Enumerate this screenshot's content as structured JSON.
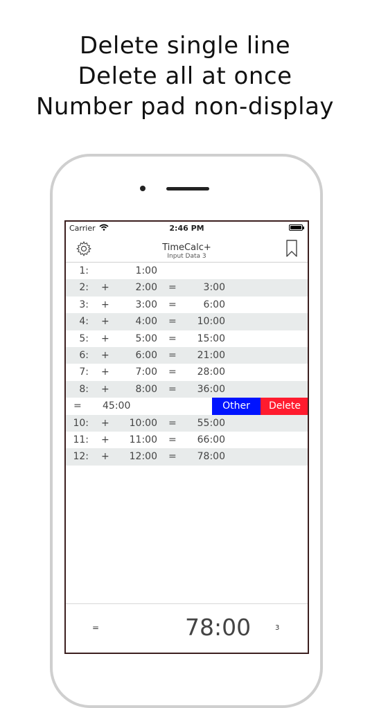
{
  "headline": {
    "line1": "Delete single line",
    "line2": "Delete all at once",
    "line3": "Number pad non-display"
  },
  "status_bar": {
    "carrier": "Carrier",
    "time": "2:46 PM"
  },
  "nav": {
    "title": "TimeCalc+",
    "subtitle": "Input Data 3",
    "left_icon": "gear-icon",
    "right_icon": "bookmark-icon"
  },
  "rows": [
    {
      "num": "1:",
      "op": "",
      "value": "1:00",
      "eq": "",
      "result": ""
    },
    {
      "num": "2:",
      "op": "+",
      "value": "2:00",
      "eq": "=",
      "result": "3:00"
    },
    {
      "num": "3:",
      "op": "+",
      "value": "3:00",
      "eq": "=",
      "result": "6:00"
    },
    {
      "num": "4:",
      "op": "+",
      "value": "4:00",
      "eq": "=",
      "result": "10:00"
    },
    {
      "num": "5:",
      "op": "+",
      "value": "5:00",
      "eq": "=",
      "result": "15:00"
    },
    {
      "num": "6:",
      "op": "+",
      "value": "6:00",
      "eq": "=",
      "result": "21:00"
    },
    {
      "num": "7:",
      "op": "+",
      "value": "7:00",
      "eq": "=",
      "result": "28:00"
    },
    {
      "num": "8:",
      "op": "+",
      "value": "8:00",
      "eq": "=",
      "result": "36:00"
    }
  ],
  "swiped_row": {
    "eq": "=",
    "result": "45:00",
    "other_label": "Other",
    "delete_label": "Delete"
  },
  "rows_after": [
    {
      "num": "10:",
      "op": "+",
      "value": "10:00",
      "eq": "=",
      "result": "55:00"
    },
    {
      "num": "11:",
      "op": "+",
      "value": "11:00",
      "eq": "=",
      "result": "66:00"
    },
    {
      "num": "12:",
      "op": "+",
      "value": "12:00",
      "eq": "=",
      "result": "78:00"
    }
  ],
  "bottom": {
    "eq": "=",
    "total": "78:00",
    "count": "3"
  },
  "colors": {
    "other_button": "#0013ff",
    "delete_button": "#ff1b2e",
    "row_shade": "#e8ebeb"
  }
}
